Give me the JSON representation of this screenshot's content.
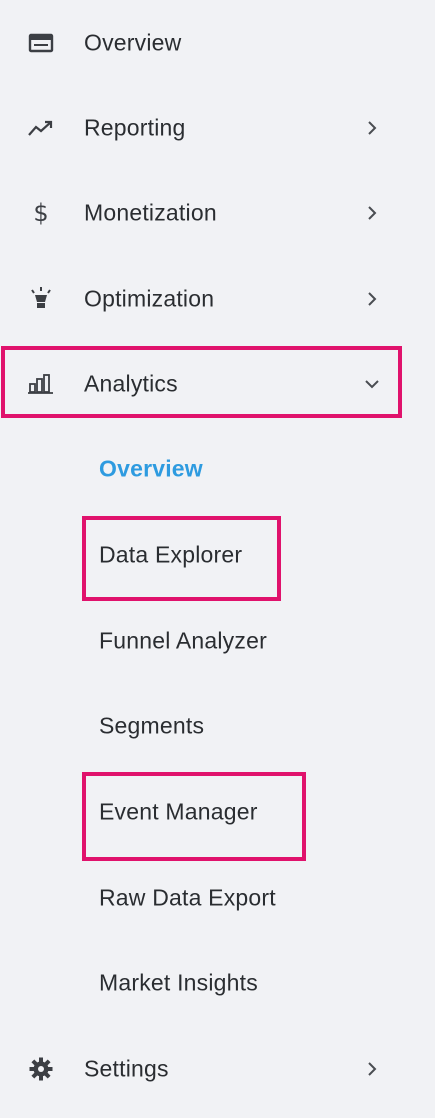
{
  "nav": {
    "items": [
      {
        "label": "Overview",
        "icon": "dashboard-icon",
        "has_chevron": false
      },
      {
        "label": "Reporting",
        "icon": "trending-up-icon",
        "has_chevron": true,
        "chevron": "right"
      },
      {
        "label": "Monetization",
        "icon": "dollar-icon",
        "has_chevron": true,
        "chevron": "right"
      },
      {
        "label": "Optimization",
        "icon": "lightbulb-icon",
        "has_chevron": true,
        "chevron": "right"
      },
      {
        "label": "Analytics",
        "icon": "bar-chart-icon",
        "has_chevron": true,
        "chevron": "down",
        "expanded": true
      },
      {
        "label": "Settings",
        "icon": "gear-icon",
        "has_chevron": true,
        "chevron": "right"
      }
    ],
    "analytics_subitems": [
      {
        "label": "Overview",
        "active": true
      },
      {
        "label": "Data Explorer",
        "active": false
      },
      {
        "label": "Funnel Analyzer",
        "active": false
      },
      {
        "label": "Segments",
        "active": false
      },
      {
        "label": "Event Manager",
        "active": false
      },
      {
        "label": "Raw Data Export",
        "active": false
      },
      {
        "label": "Market Insights",
        "active": false
      }
    ]
  },
  "colors": {
    "background": "#f1f2f5",
    "text": "#2a2d31",
    "active_subitem": "#2e9be0",
    "highlight_border": "#e0126c",
    "icon": "#3c3f44"
  }
}
